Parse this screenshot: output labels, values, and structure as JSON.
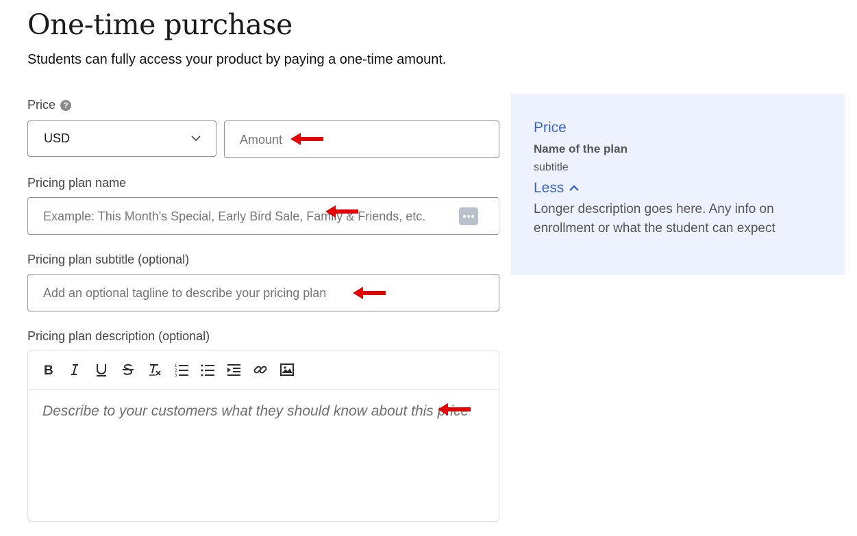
{
  "header": {
    "title": "One-time purchase",
    "subtitle": "Students can fully access your product by paying a one-time amount."
  },
  "price": {
    "label": "Price",
    "help_icon": "?",
    "currency": "USD",
    "amount_placeholder": "Amount"
  },
  "plan_name": {
    "label": "Pricing plan name",
    "placeholder": "Example: This Month's Special, Early Bird Sale, Family & Friends, etc."
  },
  "plan_subtitle": {
    "label": "Pricing plan subtitle (optional)",
    "placeholder": "Add an optional tagline to describe your pricing plan"
  },
  "plan_description": {
    "label": "Pricing plan description (optional)",
    "placeholder": "Describe to your customers what they should know about this price",
    "toolbar": [
      "bold-icon",
      "italic-icon",
      "underline-icon",
      "strikethrough-icon",
      "clear-format-icon",
      "ordered-list-icon",
      "bullet-list-icon",
      "indent-icon",
      "link-icon",
      "image-icon"
    ]
  },
  "preview": {
    "price": "Price",
    "name": "Name of the plan",
    "subtitle": "subtitle",
    "toggle": "Less",
    "description": "Longer description goes here. Any info on enrollment or what the student can expect"
  },
  "colors": {
    "accent": "#3f66c6",
    "preview_bg": "#edf2fe",
    "annotation_arrow": "#e30000"
  }
}
